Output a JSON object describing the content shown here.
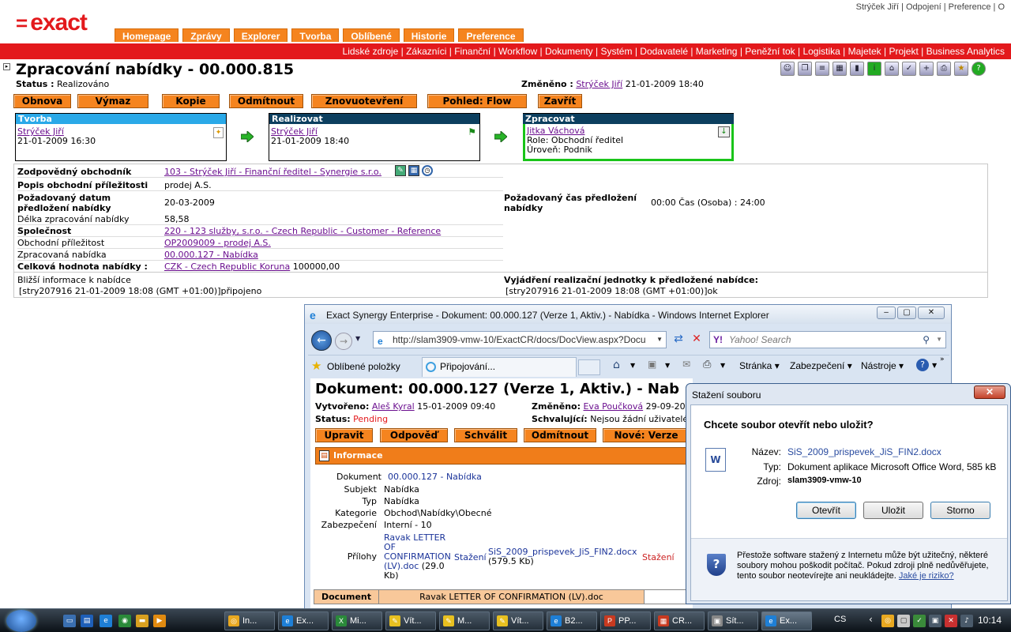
{
  "app": {
    "logo_symbol": "=",
    "logo_text": "exact",
    "brand_color": "#e3191c",
    "tab_color": "#f5841f"
  },
  "toplinks": [
    "Strýček Jiří",
    "Odpojení",
    "Preference",
    "O"
  ],
  "tabs": [
    "Homepage",
    "Zprávy",
    "Explorer",
    "Tvorba",
    "Oblíbené",
    "Historie",
    "Preference"
  ],
  "modules": [
    "Lidské zdroje",
    "Zákazníci",
    "Finanční",
    "Workflow",
    "Dokumenty",
    "Systém",
    "Dodavatelé",
    "Marketing",
    "Peněžní tok",
    "Logistika",
    "Majetek",
    "Projekt",
    "Business Analytics"
  ],
  "page": {
    "title": "Zpracování nabídky - 00.000.815",
    "status_label": "Status :",
    "status_value": "Realizováno",
    "changed_label": "Změněno :",
    "changed_user": "Strýček Jiří",
    "changed_date": "21-01-2009 18:40"
  },
  "actions": [
    "Obnova",
    "Výmaz",
    "Kopie",
    "Odmítnout",
    "Znovuotevření",
    "Pohled: Flow",
    "Zavřít"
  ],
  "workflow": [
    {
      "header": "Tvorba",
      "user": "Strýček Jiří",
      "line2": "21-01-2009 16:30",
      "line3": ""
    },
    {
      "header": "Realizovat",
      "user": "Strýček Jiří",
      "line2": "21-01-2009 18:40",
      "line3": ""
    },
    {
      "header": "Zpracovat",
      "user": "Jitka Váchová",
      "line2": "Role: Obchodní ředitel",
      "line3": "Úroveň: Podnik"
    }
  ],
  "details": {
    "responsible_label": "Zodpovědný obchodník",
    "responsible_value": "103 - Strýček Jiří - Finanční ředitel - Synergie s.r.o.",
    "opp_desc_label": "Popis obchodní příležitosti",
    "opp_desc_value": "prodej A.S.",
    "req_date_label": "Požadovaný datum předložení nabídky",
    "req_date_value": "20-03-2009",
    "req_time_label": "Požadovaný čas předložení nabídky",
    "req_time_value": "00:00 Čas (Osoba) : 24:00",
    "length_label": "Délka zpracování nabídky",
    "length_value": "58,58",
    "company_label": "Společnost",
    "company_value": "220 - 123 služby, s.r.o. - Czech Republic - Customer - Reference",
    "opportunity_label": "Obchodní příležitost",
    "opportunity_value": "OP2009009 - prodej A.S.",
    "processed_label": "Zpracovaná nabídka",
    "processed_value": "00.000.127 - Nabídka",
    "total_label": "Celková hodnota nabídky :",
    "total_currency": "CZK - Czech Republic Koruna",
    "total_amount": "100000,00",
    "info_label": "Bližší informace k nabídce",
    "info_value": "[stry207916 21-01-2009 18:08 (GMT +01:00)]připojeno",
    "unit_label": "Vyjádření realizační jednotky k předložené nabídce:",
    "unit_value": "[stry207916 21-01-2009 18:08 (GMT +01:00)]ok"
  },
  "ie": {
    "title": "Exact Synergy Enterprise - Dokument: 00.000.127 (Verze 1, Aktiv.) - Nabídka - Windows Internet Explorer",
    "url": "http://slam3909-vmw-10/ExactCR/docs/DocView.aspx?Docu",
    "search_placeholder": "Yahoo! Search",
    "favorites": "Oblíbené položky",
    "tab": "Připojování...",
    "menu": [
      "Stránka",
      "Zabezpečení",
      "Nástroje"
    ],
    "doc_title": "Dokument: 00.000.127 (Verze 1, Aktiv.) - Nab",
    "created_label": "Vytvořeno:",
    "created_user": "Aleš Kyral",
    "created_date": "15-01-2009 09:40",
    "changed_label": "Změněno:",
    "changed_user": "Eva Poučková",
    "changed_date": "29-09-20",
    "status_label": "Status:",
    "status_value": "Pending",
    "approvers_label": "Schvalující:",
    "approvers_value": "Nejsou žádní uživatelé",
    "buttons": [
      "Upravit",
      "Odpověď",
      "Schválit",
      "Odmítnout",
      "Nové: Verze"
    ],
    "section": "Informace",
    "rows": [
      {
        "label": "Dokument",
        "value": "00.000.127 - Nabídka"
      },
      {
        "label": "Subjekt",
        "value": "Nabídka"
      },
      {
        "label": "Typ",
        "value": "Nabídka"
      },
      {
        "label": "Kategorie",
        "value": "Obchod\\Nabídky\\Obecné"
      },
      {
        "label": "Zabezpečení",
        "value": "Interní - 10"
      }
    ],
    "att_label": "Přílohy",
    "att1": "Ravak LETTER OF CONFIRMATION (LV).doc",
    "att1_size": "(29.0 Kb)",
    "att_download": "Stažení",
    "att2": "SiS_2009_prispevek_JiS_FIN2.docx",
    "att2_size": "(579.5 Kb)",
    "table_col": "Document",
    "table_val": "Ravak LETTER OF CONFIRMATION (LV).doc"
  },
  "dialog": {
    "title": "Stažení souboru",
    "question": "Chcete soubor otevřít nebo uložit?",
    "name_label": "Název:",
    "name_value": "SiS_2009_prispevek_JiS_FIN2.docx",
    "type_label": "Typ:",
    "type_value": "Dokument aplikace Microsoft Office Word, 585 kB",
    "source_label": "Zdroj:",
    "source_value": "slam3909-vmw-10",
    "open": "Otevřít",
    "save": "Uložit",
    "cancel": "Storno",
    "warning": "Přestože software stažený z Internetu může být užitečný, některé soubory mohou poškodit počítač. Pokud zdroji plně nedůvěřujete, tento soubor neotevírejte ani neukládejte.",
    "risk_link": "Jaké je riziko?"
  },
  "taskbar": {
    "items": [
      "In...",
      "Ex...",
      "Mi...",
      "Vít...",
      "M...",
      "Vít...",
      "B2...",
      "PP...",
      "CR...",
      "Sít...",
      "Ex..."
    ],
    "lang": "CS",
    "time": "10:14"
  }
}
